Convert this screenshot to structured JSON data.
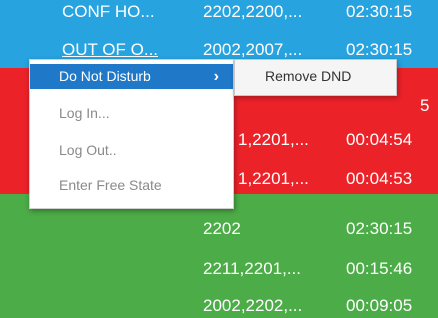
{
  "rows": [
    {
      "ids": "CONF HO...",
      "codes": "2202,2200,...",
      "time": "02:30:15",
      "color": "#27a3df"
    },
    {
      "ids": "OUT OF O...",
      "codes": "2002,2007,...",
      "time": "02:30:15",
      "color": "#27a3df"
    },
    {
      "ids": "",
      "codes": "",
      "time": "",
      "color": "#ec2229"
    },
    {
      "ids": "",
      "codes": "1,2201,...",
      "time": "00:04:54",
      "color": "#ec2229"
    },
    {
      "ids": "",
      "codes": "1,2201,...",
      "time": "00:04:53",
      "color": "#ec2229"
    },
    {
      "ids": "",
      "codes": "2202",
      "time": "02:30:15",
      "color": "#4cac47"
    },
    {
      "ids": "",
      "codes": "2211,2201,...",
      "time": "00:15:46",
      "color": "#4cac47"
    },
    {
      "ids": "",
      "codes": "2002,2202,...",
      "time": "00:09:05",
      "color": "#4cac47"
    }
  ],
  "context_menu": {
    "items": [
      {
        "label": "Do Not Disturb",
        "state": "selected",
        "has_submenu": true
      },
      {
        "label": "Log In...",
        "state": "disabled"
      },
      {
        "label": "Log Out..",
        "state": "disabled"
      },
      {
        "label": "Enter Free State",
        "state": "disabled"
      }
    ],
    "arrow_glyph": "›",
    "selected_color": "#1f78c8"
  },
  "submenu": {
    "items": [
      {
        "label": "Remove DND"
      }
    ]
  }
}
